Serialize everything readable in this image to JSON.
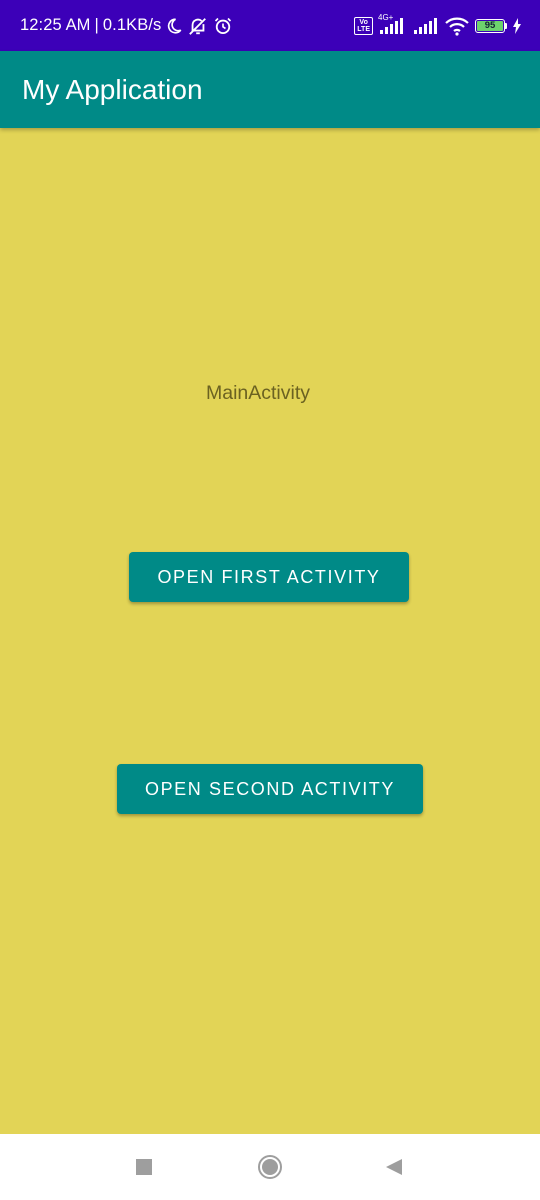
{
  "status_bar": {
    "time": "12:25 AM",
    "separator": "|",
    "speed": "0.1KB/s",
    "volte": "Vo LTE",
    "network_tag": "4G+",
    "battery_level": "95",
    "icons": [
      "moon-icon",
      "bell-off-icon",
      "alarm-icon",
      "volte-icon",
      "signal-icon",
      "wifi-icon",
      "battery-icon",
      "charging-icon"
    ],
    "background_color": "#3c00b8"
  },
  "app_bar": {
    "title": "My Application",
    "color": "#008a87"
  },
  "main": {
    "label": "MainActivity",
    "background_color": "#e2d456",
    "buttons": {
      "first": "OPEN FIRST ACTIVITY",
      "second": "OPEN SECOND ACTIVITY"
    },
    "button_color": "#008a87"
  },
  "nav_bar": {
    "icons": [
      "recent-apps-icon",
      "home-icon",
      "back-icon"
    ]
  }
}
